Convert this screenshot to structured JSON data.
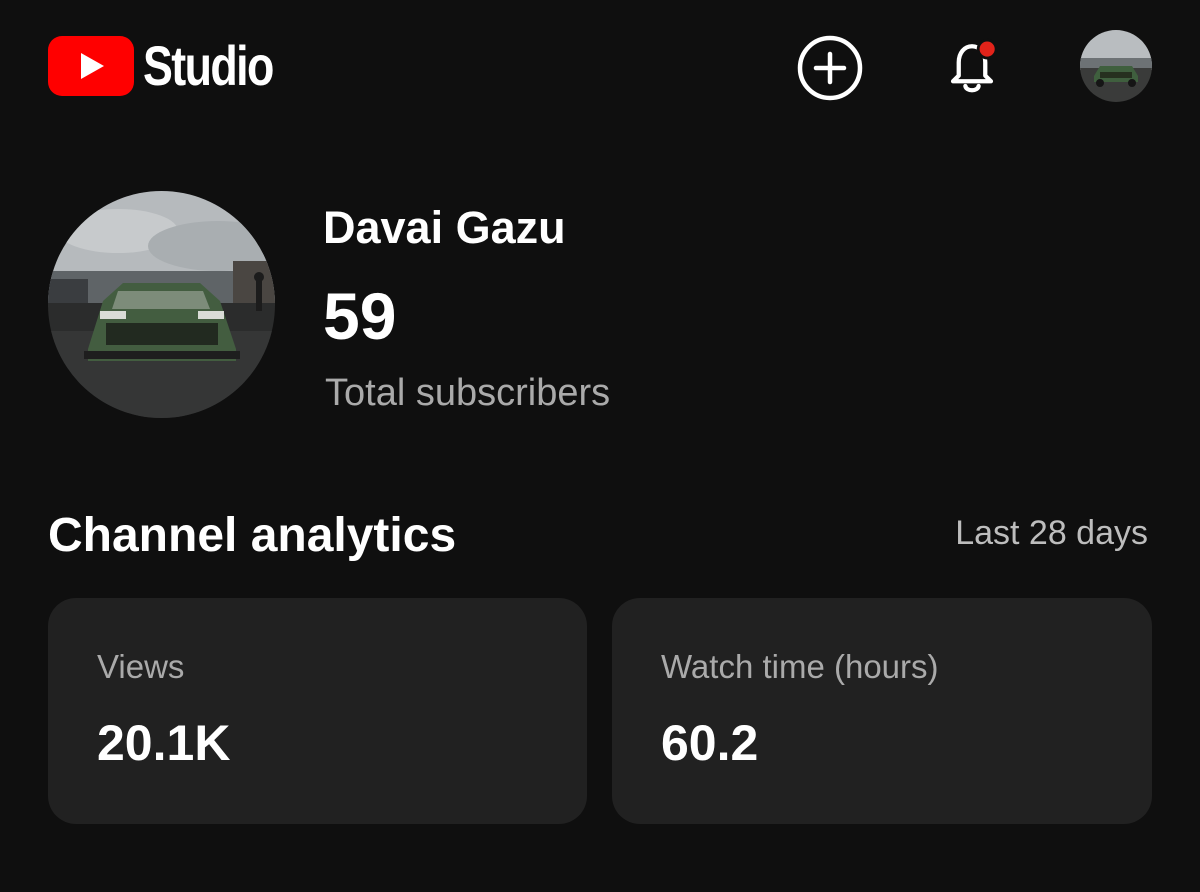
{
  "app": {
    "logo_text": "Studio",
    "brand_color": "#ff0000",
    "notification_dot_color": "#e2231a"
  },
  "header": {
    "icons": [
      "youtube-logo-icon",
      "create-plus-icon",
      "notifications-bell-icon",
      "account-avatar"
    ]
  },
  "channel": {
    "name": "Davai Gazu",
    "subscriber_count": "59",
    "subscriber_label": "Total subscribers"
  },
  "analytics": {
    "title": "Channel analytics",
    "period": "Last 28 days",
    "cards": [
      {
        "label": "Views",
        "value": "20.1K"
      },
      {
        "label": "Watch time (hours)",
        "value": "60.2"
      }
    ]
  }
}
